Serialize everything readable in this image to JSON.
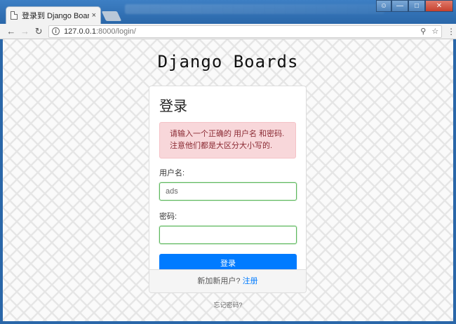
{
  "browser": {
    "tab_title": "登录到 Django Boards",
    "tab_close": "×",
    "url_host": "127.0.0.1",
    "url_path": ":8000/login/"
  },
  "page": {
    "brand": "Django Boards",
    "login_title": "登录",
    "error_line1": "请输入一个正确的 用户名 和密码.",
    "error_line2": "注意他们都是大区分大小写的.",
    "username_label": "用户名:",
    "username_value": "ads",
    "password_label": "密码:",
    "password_value": "",
    "submit_label": "登录",
    "footer_prompt": "新加新用户?",
    "signup_link": "注册",
    "forgot_link": "忘记密码?"
  },
  "colors": {
    "accent": "#007bff",
    "alert_bg": "#f8d7da",
    "input_border": "#5cb85c"
  }
}
